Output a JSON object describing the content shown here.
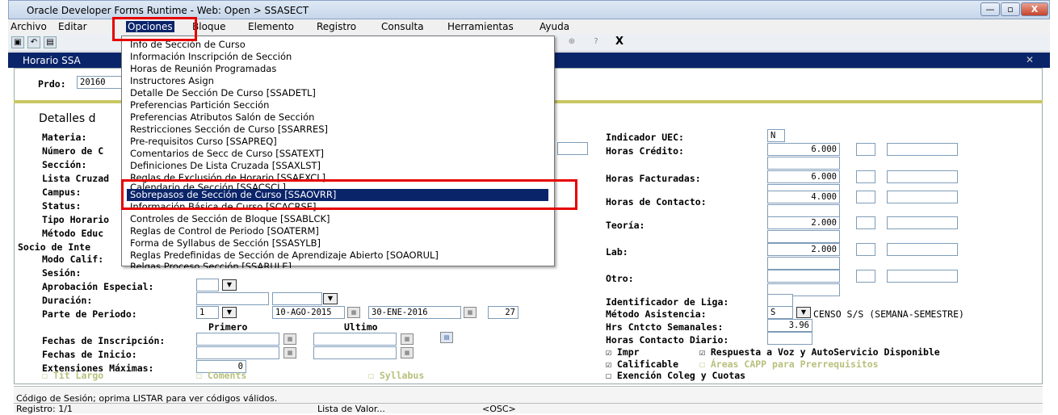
{
  "window": {
    "title": "Oracle Developer Forms Runtime - Web:  Open > SSASECT",
    "min_label": "—",
    "max_label": "▫",
    "close_label": "X"
  },
  "menubar": {
    "items": [
      "Archivo",
      "Editar",
      "Opciones",
      "Bloque",
      "Elemento",
      "Registro",
      "Consulta",
      "Herramientas",
      "Ayuda"
    ]
  },
  "toolbar": {
    "close_glyph": "X"
  },
  "form": {
    "title": "Horario  SSA"
  },
  "key": {
    "prdo_label": "Prdo:",
    "prdo_value": "20160"
  },
  "section": {
    "title": "Detalles d"
  },
  "left_labels": {
    "materia": "Materia:",
    "numero": "Número de C",
    "seccion": "Sección:",
    "lista": "Lista Cruzad",
    "campus": "Campus:",
    "status": "Status:",
    "tipo": "Tipo Horario",
    "metodo": "Método Educ",
    "socio": "Socio de Inte",
    "modo": "Modo Calif:",
    "sesion": "Sesión:",
    "aprobacion": "Aprobación Especial:",
    "duracion": "Duración:",
    "parte": "Parte de Periodo:",
    "primero": "Primero",
    "ultimo": "Ultimo",
    "fechas_insc": "Fechas de Inscripción:",
    "fechas_inicio": "Fechas de Inicio:",
    "ext_max": "Extensiones Máximas:"
  },
  "left_values": {
    "parte": "1",
    "fecha_ini": "10-AGO-2015",
    "fecha_fin": "30-ENE-2016",
    "semanas": "27",
    "ext_max": "0"
  },
  "right": {
    "uec_label": "Indicador UEC:",
    "uec_value": "N",
    "credito_label": "Horas Crédito:",
    "credito_value": "6.000",
    "facturadas_label": "Horas Facturadas:",
    "facturadas_value": "6.000",
    "contacto_label": "Horas de Contacto:",
    "contacto_value": "4.000",
    "teoria_label": "Teoría:",
    "teoria_value": "2.000",
    "lab_label": "Lab:",
    "lab_value": "2.000",
    "otro_label": "Otro:",
    "liga_label": "Identificador de Liga:",
    "asistencia_label": "Método Asistencia:",
    "asistencia_value": "S",
    "asistencia_desc": "CENSO S/S (SEMANA-SEMESTRE)",
    "hrs_sem_label": "Hrs Cntcto Semanales:",
    "hrs_sem_value": "3.96",
    "hrs_diario_label": "Horas Contacto Diario:"
  },
  "checks": {
    "impr": "Impr",
    "respuesta": "Respuesta a Voz y AutoServicio Disponible",
    "calificable": "Calificable",
    "capp": "Áreas CAPP para Prerrequisitos",
    "tit_largo": "Tít Largo",
    "coments": "Coments",
    "syllabus": "Syllabus",
    "exencion": "Exención Coleg y Cuotas"
  },
  "menu": {
    "items": [
      "Info de Sección de Curso",
      "Información Inscripción de Sección",
      "Horas de Reunión Programadas",
      "Instructores Asign",
      "Detalle De Sección De Curso [SSADETL]",
      "Preferencias Partición Sección",
      "Preferencias Atributos Salón de Sección",
      "Restricciones Sección de Curso [SSARRES]",
      "Pre-requisitos Curso [SSAPREQ]",
      "Comentarios de Secc de Curso [SSATEXT]",
      "Definiciones De Lista Cruzada [SSAXLST]",
      "Reglas de Exclusión de Horario [SSAEXCL]",
      "Calendario de Sección [SSACSCL]",
      "Sobrepasos de Sección de Curso [SSAOVRR]",
      "Información Básica de Curso [SCACRSE]",
      "Controles de Sección de Bloque [SSABLCK]",
      "Reglas de Control de Periodo [SOATERM]",
      "Forma de Syllabus de Sección [SSASYLB]",
      "Reglas Predefinidas de Sección de Aprendizaje Abierto [SOAORUL]",
      "Relgas Proceso Sección [SSARULE]"
    ]
  },
  "status": {
    "message": "Código de Sesión; oprima LISTAR para ver códigos válidos.",
    "record": "Registro: 1/1",
    "lov": "Lista de Valor...",
    "osc": "<OSC>"
  }
}
